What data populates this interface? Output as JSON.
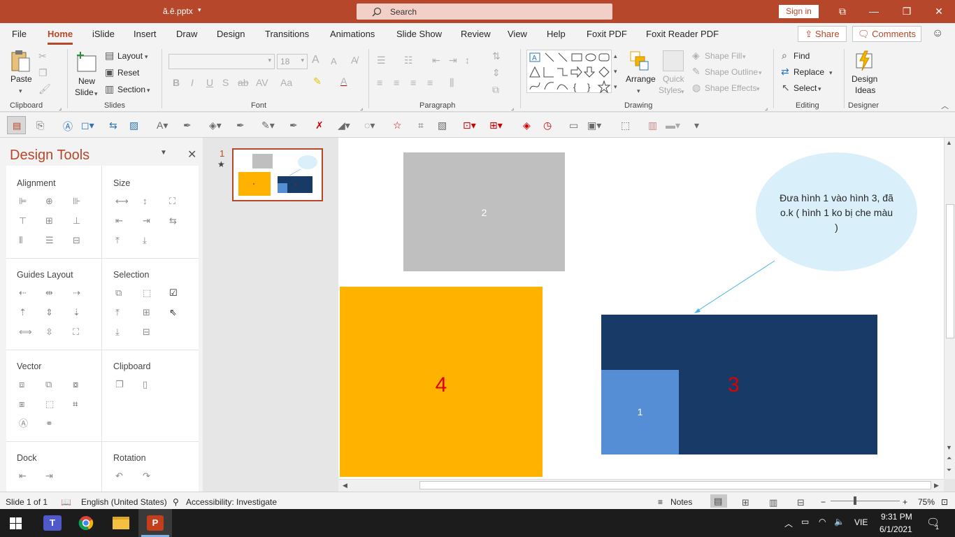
{
  "titlebar": {
    "filename": "ă.ê.pptx",
    "search_placeholder": "Search",
    "signin": "Sign in",
    "minimize": "—",
    "restore": "❐",
    "close": "✕",
    "ribbon_display": "⧉"
  },
  "tabs": [
    "File",
    "Home",
    "iSlide",
    "Insert",
    "Draw",
    "Design",
    "Transitions",
    "Animations",
    "Slide Show",
    "Review",
    "View",
    "Help",
    "Foxit PDF",
    "Foxit Reader PDF"
  ],
  "active_tab": "Home",
  "share": "Share",
  "comments": "Comments",
  "ribbon": {
    "clipboard": {
      "label": "Clipboard",
      "paste": "Paste"
    },
    "slides": {
      "label": "Slides",
      "new_slide": "New",
      "new_slide2": "Slide",
      "layout": "Layout",
      "reset": "Reset",
      "section": "Section"
    },
    "font": {
      "label": "Font",
      "font_size": "18"
    },
    "paragraph": {
      "label": "Paragraph"
    },
    "drawing": {
      "label": "Drawing",
      "arrange": "Arrange",
      "quick_styles": "Quick",
      "quick_styles2": "Styles",
      "shape_fill": "Shape Fill",
      "shape_outline": "Shape Outline",
      "shape_effects": "Shape Effects"
    },
    "editing": {
      "label": "Editing",
      "find": "Find",
      "replace": "Replace",
      "select": "Select"
    },
    "designer": {
      "label": "Designer",
      "design_ideas": "Design",
      "design_ideas2": "Ideas"
    }
  },
  "design_panel": {
    "title": "Design Tools",
    "sections": {
      "alignment": "Alignment",
      "size": "Size",
      "guides_layout": "Guides Layout",
      "selection": "Selection",
      "vector": "Vector",
      "clipboard": "Clipboard",
      "dock": "Dock",
      "rotation": "Rotation"
    }
  },
  "thumbnail": {
    "number": "1",
    "star": "★"
  },
  "slide": {
    "shape2_label": "2",
    "shape4_label": "4",
    "shape3_label": "3",
    "shape1_label": "1",
    "callout_text": "Đưa hình 1 vào hình 3, đã o.k ( hình 1 ko bị che màu )",
    "colors": {
      "gray": "#bfbfbf",
      "orange": "#ffb300",
      "navy": "#173a67",
      "blue": "#558ed5",
      "callout": "#d9f0fa",
      "red": "#e00000",
      "arrow": "#4ab3e3"
    }
  },
  "statusbar": {
    "slide_info": "Slide 1 of 1",
    "language": "English (United States)",
    "accessibility": "Accessibility: Investigate",
    "notes": "Notes",
    "zoom": "75%"
  },
  "taskbar": {
    "language": "VIE",
    "time": "9:31 PM",
    "date": "6/1/2021",
    "notif_count": "1"
  }
}
